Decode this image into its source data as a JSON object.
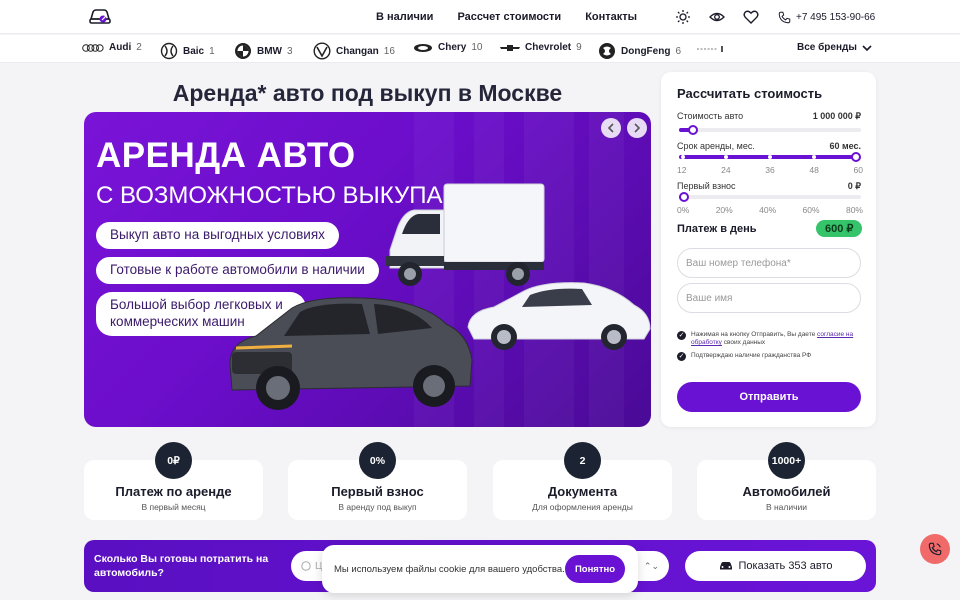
{
  "header": {
    "nav": [
      "В наличии",
      "Рассчет стоимости",
      "Контакты"
    ],
    "phone": "+7 495 153-90-66",
    "icons": [
      "sun-icon",
      "eye-icon",
      "heart-icon",
      "phone-icon"
    ]
  },
  "brands": {
    "items": [
      {
        "name": "Audi",
        "count": "2"
      },
      {
        "name": "Baic",
        "count": "1"
      },
      {
        "name": "BMW",
        "count": "3"
      },
      {
        "name": "Changan",
        "count": "16"
      },
      {
        "name": "Chery",
        "count": "10"
      },
      {
        "name": "Chevrolet",
        "count": "9"
      },
      {
        "name": "DongFeng",
        "count": "6"
      }
    ],
    "all_label": "Все бренды"
  },
  "page_title": "Аренда* авто под выкуп в Москве",
  "banner": {
    "headline": "АРЕНДА АВТО",
    "subheadline": "С ВОЗМОЖНОСТЬЮ ВЫКУПА!",
    "pills": [
      "Выкуп авто на выгодных условиях",
      "Готовые к работе автомобили в наличии",
      "Большой выбор легковых и коммерческих машин"
    ]
  },
  "calculator": {
    "title": "Рассчитать стоимость",
    "cost_label": "Стоимость авто",
    "cost_value": "1 000 000 ₽",
    "cost_fraction": 0.05,
    "term_label": "Срок аренды, мес.",
    "term_value": "60 мес.",
    "term_ticks": [
      "12",
      "24",
      "36",
      "48",
      "60"
    ],
    "term_fraction": 1.0,
    "down_label": "Первый взнос",
    "down_value": "0 ₽",
    "down_ticks": [
      "0%",
      "20%",
      "40%",
      "60%",
      "80%"
    ],
    "down_fraction": 0.0,
    "per_day_label": "Платеж в день",
    "per_day_value": "600 ₽",
    "phone_placeholder": "Ваш номер телефона*",
    "name_placeholder": "Ваше имя",
    "consent_prefix": "Нажимая на кнопку Отправить, Вы даете",
    "consent_link": "согласие на обработку",
    "consent_suffix": "своих данных",
    "citizenship": "Подтверждаю наличие гражданства РФ",
    "submit": "Отправить"
  },
  "features": [
    {
      "badge": "0₽",
      "title": "Платеж по аренде",
      "sub": "В первый месяц"
    },
    {
      "badge": "0%",
      "title": "Первый взнос",
      "sub": "В аренду под выкуп"
    },
    {
      "badge": "2",
      "title": "Документа",
      "sub": "Для оформления аренды"
    },
    {
      "badge": "1000+",
      "title": "Автомобилей",
      "sub": "В наличии"
    }
  ],
  "budget": {
    "question": "Сколько Вы готовы потратить на автомобиль?",
    "select_value": "Ц",
    "show_button": "Показать 353 авто"
  },
  "cookie": {
    "text": "Мы используем файлы cookie для вашего удобства.",
    "button": "Понятно"
  },
  "colors": {
    "accent": "#6a12d4",
    "badge_green": "#35c46a",
    "call_button": "#f06a6a",
    "dark_badge": "#1c2433"
  }
}
